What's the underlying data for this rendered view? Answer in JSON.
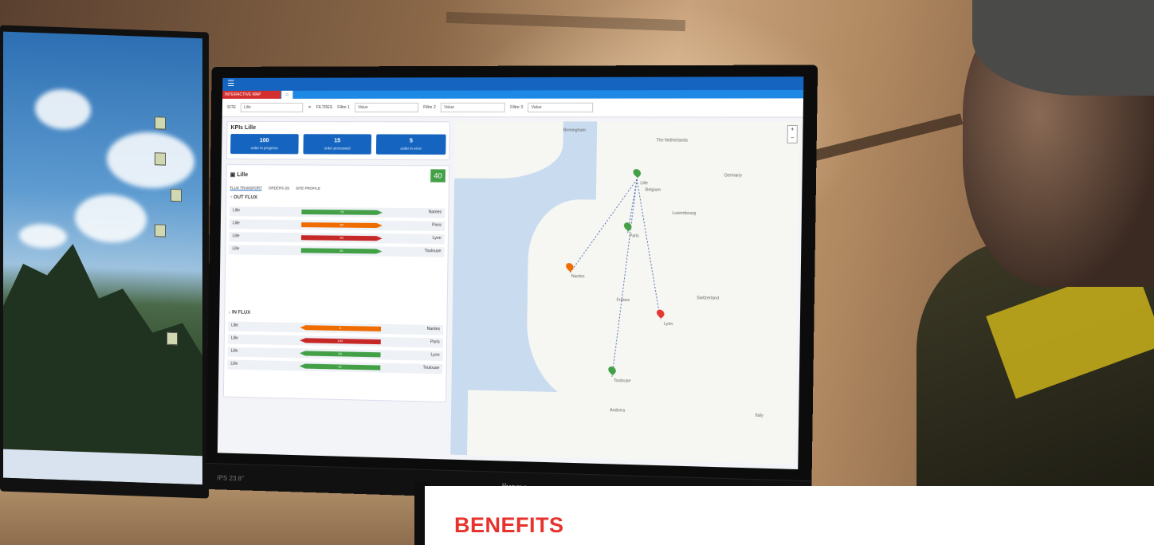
{
  "section_title": "BENEFITS",
  "monitor": {
    "brand": "iiyama",
    "info": "IPS  23.8\""
  },
  "app": {
    "tab_label": "INTERACTIVE MAP",
    "home_icon": "home-icon",
    "filters": {
      "site_label": "SITE",
      "site_value": "Lille",
      "filtres_label": "FILTRES",
      "filtre1_label": "Filtre 1",
      "filtre2_label": "Filtre 2",
      "filtre3_label": "Filtre 3",
      "placeholder": "Value"
    },
    "kpis": {
      "title": "KPIs Lille",
      "items": [
        {
          "value": "100",
          "label": "order in progress"
        },
        {
          "value": "15",
          "label": "order processed"
        },
        {
          "value": "5",
          "label": "order in error"
        }
      ]
    },
    "site": {
      "name": "Lille",
      "badge": "40",
      "tabs": [
        "FLUX TRANSPORT",
        "ORDERS (0)",
        "SITE PROFILE"
      ],
      "out_title": "OUT FLUX",
      "in_title": "IN FLUX",
      "out_rows": [
        {
          "from": "Lille",
          "to": "Nantes",
          "value": "75",
          "color": "#43a047"
        },
        {
          "from": "Lille",
          "to": "Paris",
          "value": "50",
          "color": "#ef6c00"
        },
        {
          "from": "Lille",
          "to": "Lyon",
          "value": "95",
          "color": "#c62828"
        },
        {
          "from": "Lille",
          "to": "Toulouse",
          "value": "30",
          "color": "#43a047"
        }
      ],
      "in_rows": [
        {
          "from": "Lille",
          "to": "Nantes",
          "value": "5",
          "color": "#ef6c00"
        },
        {
          "from": "Lille",
          "to": "Paris",
          "value": "100",
          "color": "#c62828"
        },
        {
          "from": "Lille",
          "to": "Lyon",
          "value": "25",
          "color": "#43a047"
        },
        {
          "from": "Lille",
          "to": "Toulouse",
          "value": "12",
          "color": "#43a047"
        }
      ]
    },
    "map": {
      "labels": [
        "Birmingham",
        "The Netherlands",
        "Belgium",
        "Luxembourg",
        "Germany",
        "Switzerland",
        "France",
        "Paris",
        "Lille",
        "Nantes",
        "Lyon",
        "Toulouse",
        "Andorra",
        "Italy"
      ],
      "zoom_in": "+",
      "zoom_out": "−"
    }
  }
}
